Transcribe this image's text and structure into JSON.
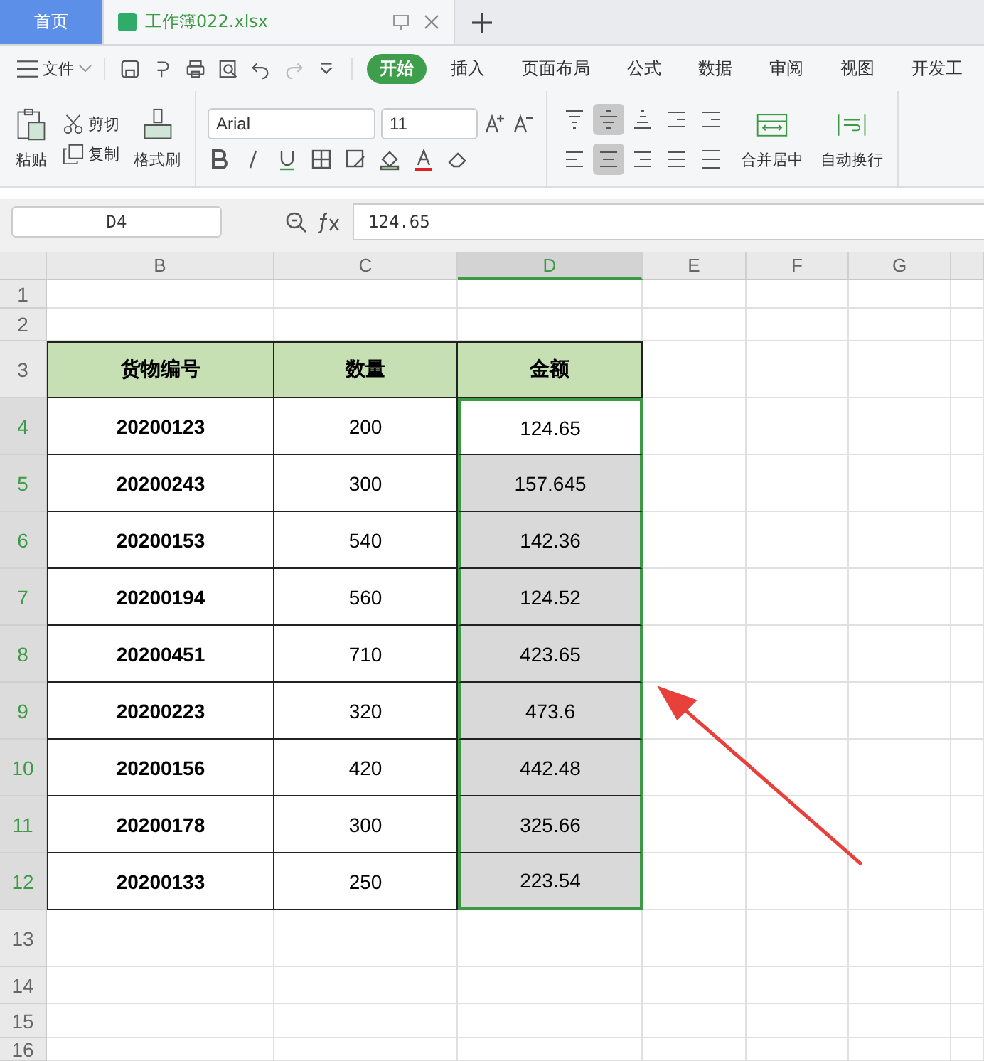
{
  "tabs": [
    {
      "label": "首页",
      "selected": false,
      "kind": "home"
    },
    {
      "label": "工作簿022.xlsx",
      "selected": true,
      "kind": "file"
    }
  ],
  "menu": {
    "file": "文件",
    "tabs": [
      {
        "label": "开始",
        "selected": true
      },
      {
        "label": "插入",
        "selected": false
      },
      {
        "label": "页面布局",
        "selected": false
      },
      {
        "label": "公式",
        "selected": false
      },
      {
        "label": "数据",
        "selected": false
      },
      {
        "label": "审阅",
        "selected": false
      },
      {
        "label": "视图",
        "selected": false
      },
      {
        "label": "开发工",
        "selected": false
      }
    ]
  },
  "ribbon": {
    "paste": "粘贴",
    "cut": "剪切",
    "copy": "复制",
    "format_painter": "格式刷",
    "font": "Arial",
    "size": "11",
    "align_top": [
      {
        "kind": "top",
        "selected": false
      },
      {
        "kind": "middle",
        "selected": true
      },
      {
        "kind": "bottom",
        "selected": false
      },
      {
        "kind": "outdent",
        "selected": false
      },
      {
        "kind": "indent",
        "selected": false
      }
    ],
    "align_bottom": [
      {
        "kind": "left",
        "selected": false
      },
      {
        "kind": "center",
        "selected": true
      },
      {
        "kind": "right",
        "selected": false
      },
      {
        "kind": "justify",
        "selected": false
      },
      {
        "kind": "distribute",
        "selected": false
      }
    ],
    "merge": "合并居中",
    "wrap": "自动换行"
  },
  "formula_bar": {
    "name_box": "D4",
    "formula": "124.65"
  },
  "sheet": {
    "columns": [
      {
        "label": "B",
        "selected": false
      },
      {
        "label": "C",
        "selected": false
      },
      {
        "label": "D",
        "selected": true
      },
      {
        "label": "E",
        "selected": false
      },
      {
        "label": "F",
        "selected": false
      },
      {
        "label": "G",
        "selected": false
      }
    ],
    "rows": [
      {
        "number": "1",
        "kind": "empty",
        "selected": false
      },
      {
        "number": "2",
        "kind": "empty",
        "selected": false
      },
      {
        "number": "3",
        "kind": "header",
        "selected": false,
        "cells": [
          "货物编号",
          "数量",
          "金额"
        ]
      },
      {
        "number": "4",
        "kind": "data",
        "selected": true,
        "active": true,
        "cells": [
          "20200123",
          "200",
          "124.65"
        ]
      },
      {
        "number": "5",
        "kind": "data",
        "selected": true,
        "active": false,
        "cells": [
          "20200243",
          "300",
          "157.645"
        ]
      },
      {
        "number": "6",
        "kind": "data",
        "selected": true,
        "active": false,
        "cells": [
          "20200153",
          "540",
          "142.36"
        ]
      },
      {
        "number": "7",
        "kind": "data",
        "selected": true,
        "active": false,
        "cells": [
          "20200194",
          "560",
          "124.52"
        ]
      },
      {
        "number": "8",
        "kind": "data",
        "selected": true,
        "active": false,
        "cells": [
          "20200451",
          "710",
          "423.65"
        ]
      },
      {
        "number": "9",
        "kind": "data",
        "selected": true,
        "active": false,
        "cells": [
          "20200223",
          "320",
          "473.6"
        ]
      },
      {
        "number": "10",
        "kind": "data",
        "selected": true,
        "active": false,
        "cells": [
          "20200156",
          "420",
          "442.48"
        ]
      },
      {
        "number": "11",
        "kind": "data",
        "selected": true,
        "active": false,
        "cells": [
          "20200178",
          "300",
          "325.66"
        ]
      },
      {
        "number": "12",
        "kind": "data",
        "selected": true,
        "active": false,
        "cells": [
          "20200133",
          "250",
          "223.54"
        ]
      },
      {
        "number": "13",
        "kind": "empty",
        "selected": false
      },
      {
        "number": "14",
        "kind": "empty",
        "selected": false
      },
      {
        "number": "15",
        "kind": "empty",
        "selected": false
      },
      {
        "number": "16",
        "kind": "empty",
        "selected": false
      }
    ]
  }
}
